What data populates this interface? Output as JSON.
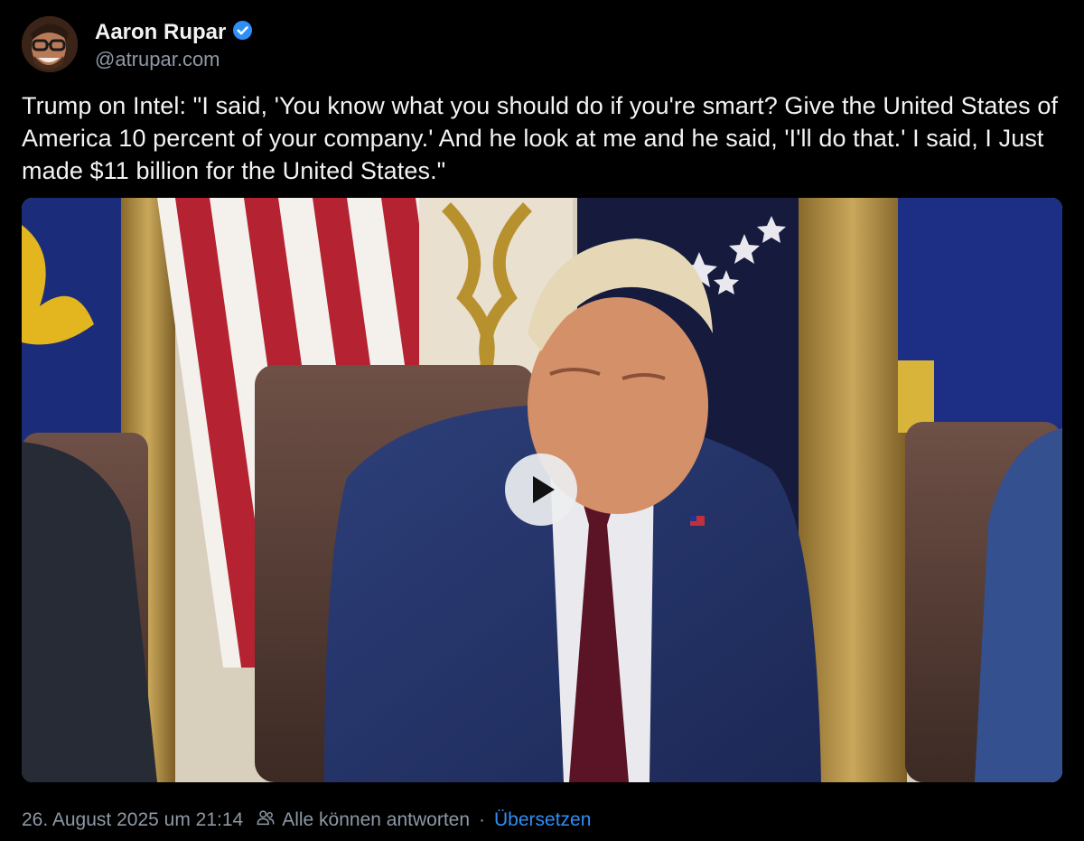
{
  "author": {
    "display_name": "Aaron Rupar",
    "handle": "@atrupar.com",
    "verified": true,
    "verified_color": "#2f8ff7"
  },
  "post": {
    "text": "Trump on Intel: \"I said, 'You know what you should do if you're smart? Give the United States of America 10 percent of your company.' And he look at me and he said, 'I'll do that.' I said, I Just made $11 billion for the United States.\"",
    "media": {
      "type": "video",
      "play_icon": "play-icon"
    }
  },
  "meta": {
    "timestamp": "26. August 2025 um 21:14",
    "reply_setting": "Alle können antworten",
    "separator": "·",
    "translate_label": "Übersetzen"
  },
  "colors": {
    "background": "#000000",
    "text": "#f1f3f5",
    "muted": "#8d99a6",
    "link": "#2f8ff7"
  }
}
